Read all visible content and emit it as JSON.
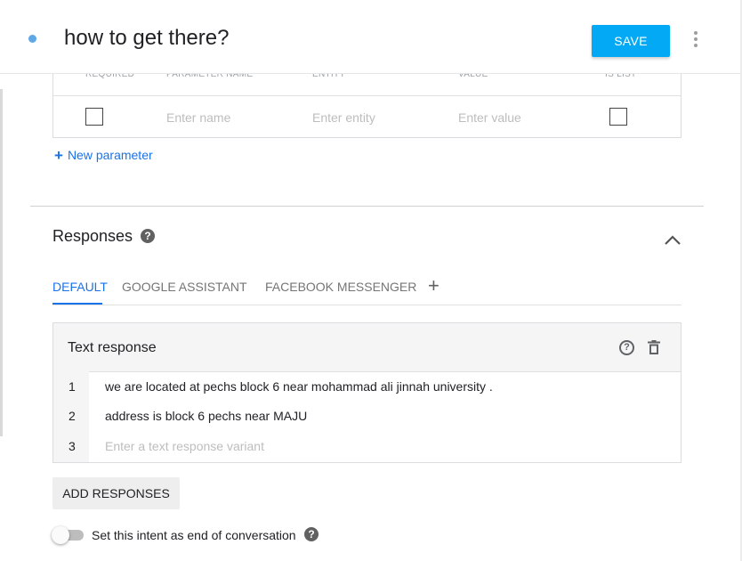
{
  "header": {
    "title": "how to get there?",
    "save_label": "SAVE"
  },
  "parameters": {
    "columns": [
      "REQUIRED",
      "PARAMETER NAME",
      "ENTITY",
      "VALUE",
      "IS LIST"
    ],
    "row": {
      "name_placeholder": "Enter name",
      "entity_placeholder": "Enter entity",
      "value_placeholder": "Enter value"
    },
    "new_parameter_label": "New parameter"
  },
  "responses": {
    "title": "Responses",
    "tabs": [
      {
        "label": "DEFAULT",
        "active": true
      },
      {
        "label": "GOOGLE ASSISTANT",
        "active": false
      },
      {
        "label": "FACEBOOK MESSENGER",
        "active": false
      }
    ],
    "text_response": {
      "title": "Text response",
      "lines": [
        {
          "num": "1",
          "text": "we are located at pechs block 6 near mohammad ali jinnah university ."
        },
        {
          "num": "2",
          "text": "address is block 6 pechs near MAJU"
        },
        {
          "num": "3",
          "placeholder": "Enter a text response variant"
        }
      ]
    },
    "add_responses_label": "ADD RESPONSES",
    "end_conversation_label": "Set this intent as end of conversation",
    "end_conversation_enabled": false
  },
  "colors": {
    "accent": "#1a73e8",
    "save_button": "#03a9f4",
    "status_dot": "#5fa8e8"
  }
}
